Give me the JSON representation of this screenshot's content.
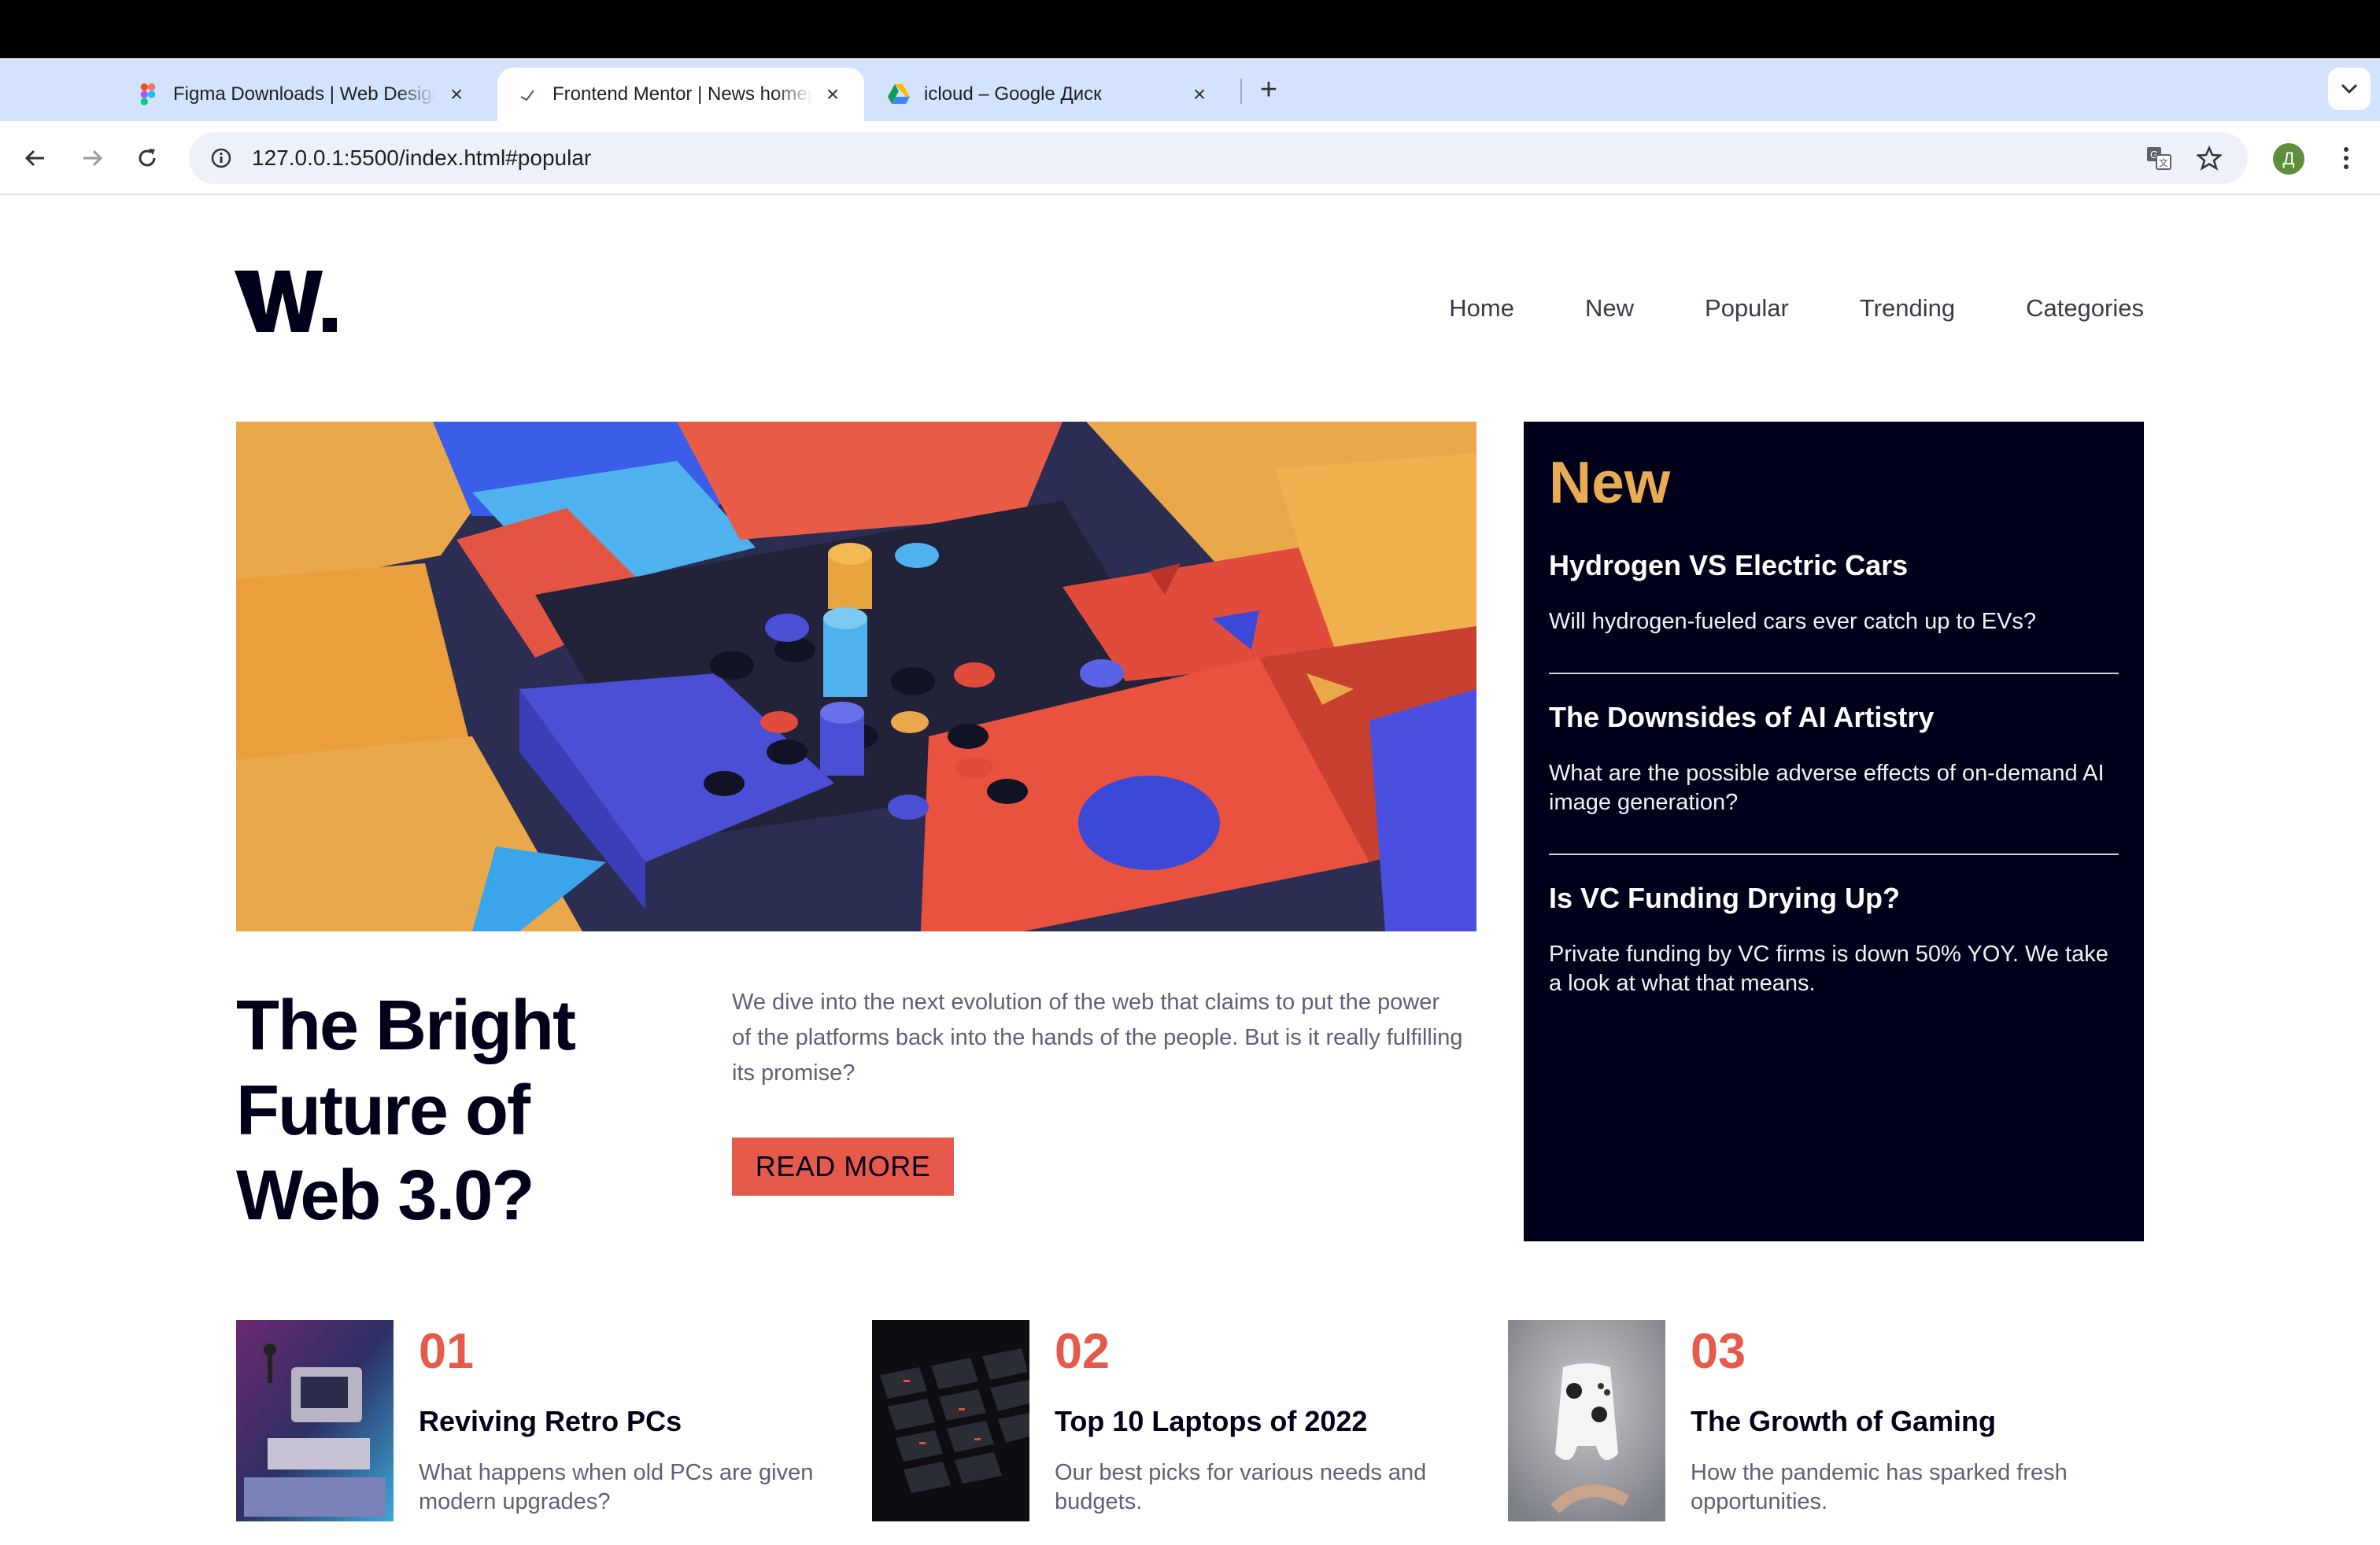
{
  "browser": {
    "tabs": [
      {
        "title": "Figma Downloads | Web Design",
        "icon": "figma-icon"
      },
      {
        "title": "Frontend Mentor | News homepage",
        "icon": "frontend-mentor-icon"
      },
      {
        "title": "icloud – Google Диск",
        "icon": "google-drive-icon"
      }
    ],
    "active_tab": 1,
    "url": "127.0.0.1:5500/index.html#popular",
    "profile_initial": "Д"
  },
  "site": {
    "logo": "W.",
    "nav": [
      "Home",
      "New",
      "Popular",
      "Trending",
      "Categories"
    ]
  },
  "feature": {
    "title": "The Bright Future of Web 3.0?",
    "description": "We dive into the next evolution of the web that claims to put the power of the platforms back into the hands of the people. But is it really fulfilling its promise?",
    "cta": "READ MORE"
  },
  "new_section": {
    "heading": "New",
    "items": [
      {
        "title": "Hydrogen VS Electric Cars",
        "summary": "Will hydrogen-fueled cars ever catch up to EVs?"
      },
      {
        "title": "The Downsides of AI Artistry",
        "summary": "What are the possible adverse effects of on-demand AI image generation?"
      },
      {
        "title": "Is VC Funding Drying Up?",
        "summary": "Private funding by VC firms is down 50% YOY. We take a look at what that means."
      }
    ]
  },
  "cards": [
    {
      "number": "01",
      "title": "Reviving Retro PCs",
      "summary": "What happens when old PCs are given modern upgrades?"
    },
    {
      "number": "02",
      "title": "Top 10 Laptops of 2022",
      "summary": "Our best picks for various needs and budgets."
    },
    {
      "number": "03",
      "title": "The Growth of Gaming",
      "summary": "How the pandemic has sparked fresh opportunities."
    }
  ],
  "colors": {
    "accent_red": "#e55a4a",
    "accent_orange": "#e9ab53",
    "dark_navy": "#00001a",
    "text_gray": "#5e607a"
  }
}
